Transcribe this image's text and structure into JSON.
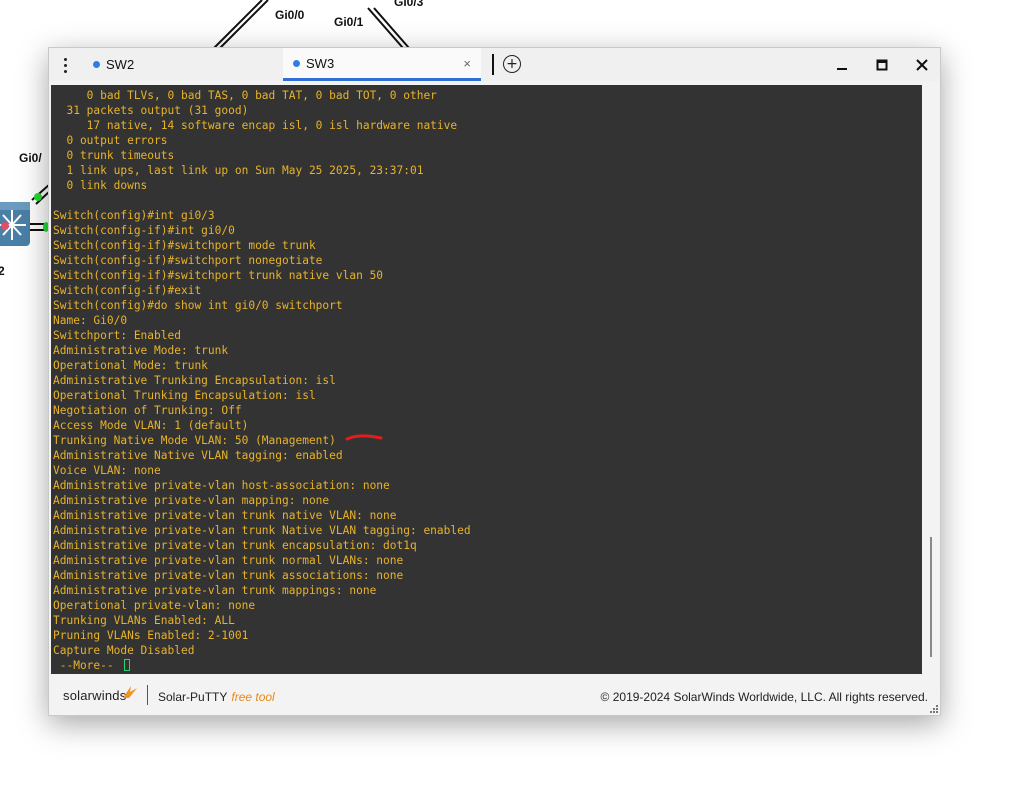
{
  "topology": {
    "labels": [
      "Gi0/0",
      "Gi0/1",
      "Gi0/3",
      "Gi0/",
      "2"
    ],
    "switch_icon": "multilayer-switch-icon",
    "link_status_color": "#22dd33"
  },
  "window": {
    "tabs": [
      {
        "label": "SW2",
        "active": false
      },
      {
        "label": "SW3",
        "active": true
      }
    ],
    "tab_close_glyph": "×",
    "add_tab_glyph": "+",
    "menu_icon": "kebab-menu-icon",
    "controls": {
      "minimize": "minimize-icon",
      "maximize": "maximize-icon",
      "close": "close-icon"
    }
  },
  "terminal": {
    "lines": [
      "     0 bad TLVs, 0 bad TAS, 0 bad TAT, 0 bad TOT, 0 other",
      "  31 packets output (31 good)",
      "     17 native, 14 software encap isl, 0 isl hardware native",
      "  0 output errors",
      "  0 trunk timeouts",
      "  1 link ups, last link up on Sun May 25 2025, 23:37:01",
      "  0 link downs",
      "",
      "Switch(config)#int gi0/3",
      "Switch(config-if)#int gi0/0",
      "Switch(config-if)#switchport mode trunk",
      "Switch(config-if)#switchport nonegotiate",
      "Switch(config-if)#switchport trunk native vlan 50",
      "Switch(config-if)#exit",
      "Switch(config)#do show int gi0/0 switchport",
      "Name: Gi0/0",
      "Switchport: Enabled",
      "Administrative Mode: trunk",
      "Operational Mode: trunk",
      "Administrative Trunking Encapsulation: isl",
      "Operational Trunking Encapsulation: isl",
      "Negotiation of Trunking: Off",
      "Access Mode VLAN: 1 (default)",
      "Trunking Native Mode VLAN: 50 (Management)",
      "Administrative Native VLAN tagging: enabled",
      "Voice VLAN: none",
      "Administrative private-vlan host-association: none",
      "Administrative private-vlan mapping: none",
      "Administrative private-vlan trunk native VLAN: none",
      "Administrative private-vlan trunk Native VLAN tagging: enabled",
      "Administrative private-vlan trunk encapsulation: dot1q",
      "Administrative private-vlan trunk normal VLANs: none",
      "Administrative private-vlan trunk associations: none",
      "Administrative private-vlan trunk mappings: none",
      "Operational private-vlan: none",
      "Trunking VLANs Enabled: ALL",
      "Pruning VLANs Enabled: 2-1001",
      "Capture Mode Disabled"
    ],
    "more_prompt": " --More-- ",
    "text_color": "#e8b32a",
    "background_color": "#333333",
    "annotation_color": "#e01e1e"
  },
  "footer": {
    "brand": "solarwinds",
    "product": "Solar-PuTTY",
    "free_label": "free tool",
    "copyright": "© 2019-2024 SolarWinds Worldwide, LLC. All rights reserved."
  }
}
